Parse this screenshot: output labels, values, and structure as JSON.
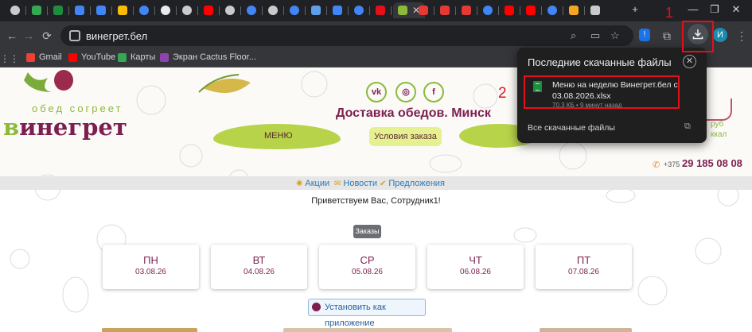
{
  "browser": {
    "tabs": [
      {
        "name": "tab-icon-chrome",
        "color": "#c9cacc",
        "round": true
      },
      {
        "name": "tab-icon-drive",
        "color": "#34a853",
        "round": false
      },
      {
        "name": "tab-icon-sheets",
        "color": "#1e8e3e",
        "round": false
      },
      {
        "name": "tab-icon-docs",
        "color": "#4285f4",
        "round": false
      },
      {
        "name": "tab-icon-docs",
        "color": "#4285f4",
        "round": false
      },
      {
        "name": "tab-icon-photos",
        "color": "#fbbc04",
        "round": false
      },
      {
        "name": "tab-icon-google",
        "color": "#4285f4",
        "round": true
      },
      {
        "name": "tab-icon-u",
        "color": "#e8eaed",
        "round": true
      },
      {
        "name": "tab-icon-globe",
        "color": "#c9cacc",
        "round": true
      },
      {
        "name": "tab-icon-youtube",
        "color": "#ff0000",
        "round": false
      },
      {
        "name": "tab-icon-globe",
        "color": "#c9cacc",
        "round": true
      },
      {
        "name": "tab-icon-google",
        "color": "#4285f4",
        "round": true
      },
      {
        "name": "tab-icon-loading",
        "color": "#c9cacc",
        "round": true
      },
      {
        "name": "tab-icon-google",
        "color": "#4285f4",
        "round": true
      },
      {
        "name": "tab-icon-app",
        "color": "#5f9ee8",
        "round": false
      },
      {
        "name": "tab-icon-docs",
        "color": "#4285f4",
        "round": false
      },
      {
        "name": "tab-icon-google",
        "color": "#4285f4",
        "round": true
      },
      {
        "name": "tab-icon-warning",
        "color": "#e3101b",
        "round": false
      },
      {
        "name": "tab-icon-vinegret",
        "color": "#8db93b",
        "round": false
      },
      {
        "name": "tab-icon-red-app",
        "color": "#e53935",
        "round": false
      },
      {
        "name": "tab-icon-red-app",
        "color": "#e53935",
        "round": false
      },
      {
        "name": "tab-icon-red-app",
        "color": "#e53935",
        "round": false
      },
      {
        "name": "tab-icon-google",
        "color": "#4285f4",
        "round": true
      },
      {
        "name": "tab-icon-youtube",
        "color": "#ff0000",
        "round": false
      },
      {
        "name": "tab-icon-youtube",
        "color": "#ff0000",
        "round": false
      },
      {
        "name": "tab-icon-google",
        "color": "#4285f4",
        "round": true
      },
      {
        "name": "tab-icon-lightning",
        "color": "#f5a623",
        "round": false
      },
      {
        "name": "tab-icon-download",
        "color": "#c9cacc",
        "round": false
      }
    ],
    "new_tab": "+",
    "window_minimize": "—",
    "window_restore": "❐",
    "window_close": "✕",
    "url": "винегрет.бел",
    "profile_initial": "И",
    "extension_badge": "!",
    "bookmarks": [
      {
        "label": "Gmail",
        "icon": "gmail-icon",
        "color": "#ea4335"
      },
      {
        "label": "YouTube",
        "icon": "youtube-icon",
        "color": "#ff0000"
      },
      {
        "label": "Карты",
        "icon": "maps-icon",
        "color": "#34a853"
      },
      {
        "label": "Экран Cactus Floor...",
        "icon": "cactus-icon",
        "color": "#8e44ad"
      }
    ]
  },
  "annotations": {
    "label_1": "1",
    "label_2": "2"
  },
  "download_popup": {
    "title": "Последние скачанные файлы",
    "close_symbol": "✕",
    "file_name": "Меню на неделю Винегрет.бел с 03.08.2026.xlsx",
    "file_meta": "70,3 КБ • 9 минут назад",
    "all_downloads": "Все скачанные файлы",
    "open_symbol": "⧉"
  },
  "site": {
    "tagline": "обед согреет",
    "logo_first_letter": "в",
    "logo_rest": "инегрет",
    "social": [
      "vk",
      "◎",
      "f"
    ],
    "delivery_title": "Доставка обедов. Минск",
    "menu_label": "МЕНЮ",
    "conditions_label": "Условия заказа",
    "price_fragment_1": "руб",
    "price_fragment_2": "ккал",
    "phone_prefix": "+375",
    "phone_number": "29 185 08 08",
    "nav_links": [
      {
        "label": "Акции",
        "icon": "✺"
      },
      {
        "label": "Новости",
        "icon": "✉"
      },
      {
        "label": "Предложения",
        "icon": "✔"
      }
    ],
    "welcome": "Приветствуем Вас, Сотрудник1!",
    "orders_label": "Заказы",
    "days": [
      {
        "day": "ПН",
        "date": "03.08.26"
      },
      {
        "day": "ВТ",
        "date": "04.08.26"
      },
      {
        "day": "СР",
        "date": "05.08.26"
      },
      {
        "day": "ЧТ",
        "date": "06.08.26"
      },
      {
        "day": "ПТ",
        "date": "07.08.26"
      }
    ],
    "install_label": "Установить как приложение"
  }
}
